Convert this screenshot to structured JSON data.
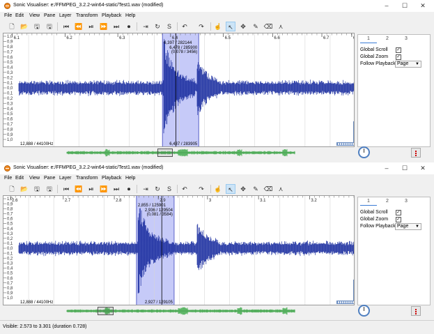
{
  "windows": [
    {
      "title": "Sonic Visualiser: e:/FFMPEG_3.2.2-win64-static/Test1.wav (modified)",
      "time_ticks": [
        {
          "label": "6.1",
          "pos": 0.025
        },
        {
          "label": "6.2",
          "pos": 0.175
        },
        {
          "label": "6.3",
          "pos": 0.325
        },
        {
          "label": "6.4",
          "pos": 0.475
        },
        {
          "label": "6.5",
          "pos": 0.625
        },
        {
          "label": "6.6",
          "pos": 0.765
        },
        {
          "label": "6.7",
          "pos": 0.905
        },
        {
          "label": "6.8",
          "pos": 0.99
        }
      ],
      "selection": {
        "start": 0.452,
        "end": 0.555,
        "cursor": 0.49
      },
      "overview_view": {
        "start": 0.44,
        "end": 0.483
      },
      "texts": {
        "sel_start": "6,397 / 282144",
        "sel_mid1": "6,478 / 285900",
        "sel_mid2": "(0,078 / 3456)",
        "bottom_left": "12,888 / 44100Hz",
        "bottom_right": "6,437 / 283905"
      },
      "seed": 7
    },
    {
      "title": "Sonic Visualiser: e:/FFMPEG_3.2.2-win64-static/Test1.wav (modified)",
      "time_ticks": [
        {
          "label": "2.6",
          "pos": 0.02
        },
        {
          "label": "2.7",
          "pos": 0.17
        },
        {
          "label": "2.8",
          "pos": 0.315
        },
        {
          "label": "2.9",
          "pos": 0.44
        },
        {
          "label": "3",
          "pos": 0.58
        },
        {
          "label": "3.1",
          "pos": 0.725
        },
        {
          "label": "3.2",
          "pos": 0.87
        }
      ],
      "selection": {
        "start": 0.378,
        "end": 0.485,
        "cursor": 0.45
      },
      "overview_view": {
        "start": 0.27,
        "end": 0.315
      },
      "texts": {
        "sel_start": "2,855 / 125901",
        "sel_mid1": "2,936 / 129504",
        "sel_mid2": "(0,081 / 3584)",
        "bottom_left": "12,888 / 44100Hz",
        "bottom_right": "2,927 / 129105"
      },
      "seed": 23
    }
  ],
  "menus": [
    "File",
    "Edit",
    "View",
    "Pane",
    "Layer",
    "Transform",
    "Playback",
    "Help"
  ],
  "amp_labels": [
    "1,0",
    "0,9",
    "0,8",
    "0,7",
    "0,6",
    "0,5",
    "0,4",
    "0,3",
    "0,2",
    "0,1",
    "0,0",
    "0,1",
    "0,2",
    "0,3",
    "0,4",
    "0,5",
    "0,6",
    "0,7",
    "0,8",
    "0,9",
    "1,0"
  ],
  "side": {
    "tabs": [
      "1",
      "2",
      "3"
    ],
    "global_scroll": "Global Scroll",
    "global_zoom": "Global Zoom",
    "follow_playback": "Follow Playback",
    "follow_value": "Page",
    "check": "✓"
  },
  "toolbar_icons": [
    "new-file",
    "open-folder",
    "save",
    "save-as",
    "rewind-start",
    "rewind",
    "play-pause",
    "fast-forward",
    "ffwd-end",
    "record",
    "play-selection",
    "loop",
    "solo",
    "undo",
    "redo",
    "navigate",
    "select",
    "move",
    "draw",
    "erase",
    "measure"
  ],
  "window_controls": {
    "minimize": "–",
    "maximize": "☐",
    "close": "✕"
  },
  "colors": {
    "waveform": "#1c2fa0",
    "selection": "#b3b8f5",
    "overview": "#3aa845"
  },
  "status": "Visible: 2.573 to 3.301 (duration 0.728)"
}
